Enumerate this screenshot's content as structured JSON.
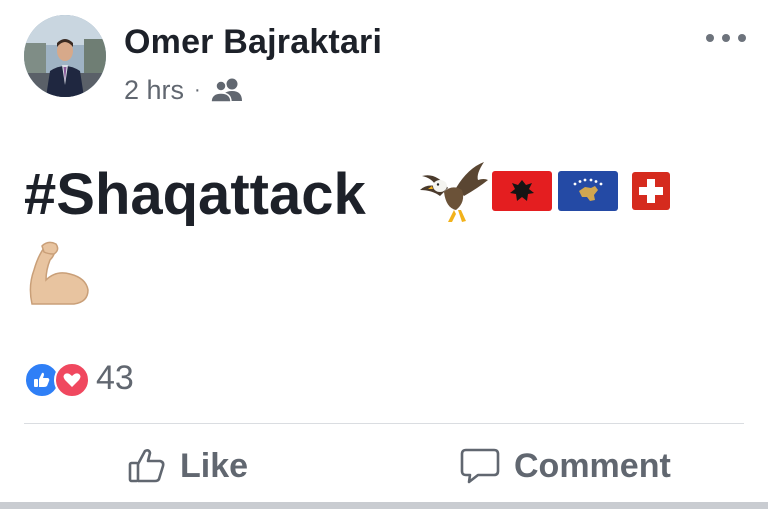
{
  "post": {
    "author": "Omer Bajraktari",
    "time": "2 hrs",
    "separator": "·",
    "audience_icon": "friends-icon",
    "text": "#Shaqattack",
    "emojis": [
      "eagle",
      "albania-flag",
      "kosovo-flag",
      "switzerland-flag",
      "flexed-biceps"
    ]
  },
  "reactions": {
    "icons": [
      "like-reaction-icon",
      "love-reaction-icon"
    ],
    "count": "43"
  },
  "actions": {
    "like_label": "Like",
    "comment_label": "Comment"
  },
  "colors": {
    "text": "#1d2129",
    "secondary": "#616770",
    "like_blue": "#2f7ff6",
    "love_red": "#f0485f",
    "albania_red": "#e41e20",
    "kosovo_blue": "#244aa5",
    "swiss_red": "#d52b1e"
  }
}
